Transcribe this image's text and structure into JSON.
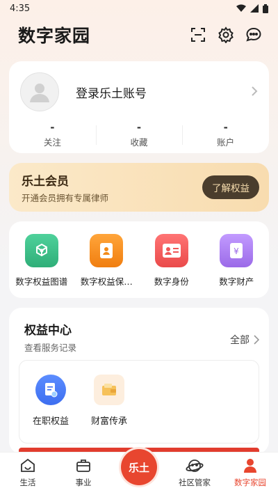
{
  "status": {
    "time": "4:35"
  },
  "header": {
    "title": "数字家园"
  },
  "profile": {
    "login": "登录乐土账号",
    "stats": [
      {
        "value": "-",
        "label": "关注"
      },
      {
        "value": "-",
        "label": "收藏"
      },
      {
        "value": "-",
        "label": "账户"
      }
    ]
  },
  "member": {
    "title": "乐土会员",
    "subtitle": "开通会员拥有专属律师",
    "button": "了解权益"
  },
  "features": [
    {
      "label": "数字权益图谱",
      "icon": "graph-icon",
      "color": "#3cc08c"
    },
    {
      "label": "数字权益保…",
      "icon": "contact-card-icon",
      "color": "#f7941d"
    },
    {
      "label": "数字身份",
      "icon": "id-card-icon",
      "color": "#f25a5a"
    },
    {
      "label": "数字财产",
      "icon": "yen-card-icon",
      "color": "#a97cf0"
    }
  ],
  "rights": {
    "title": "权益中心",
    "subtitle": "查看服务记录",
    "all": "全部",
    "items": [
      {
        "label": "在职权益",
        "icon": "document-icon"
      },
      {
        "label": "财富传承",
        "icon": "wallet-icon"
      }
    ]
  },
  "tabs": [
    {
      "label": "生活",
      "icon": "smile-house-icon"
    },
    {
      "label": "事业",
      "icon": "briefcase-icon"
    },
    {
      "label": "乐土",
      "icon": "center-logo"
    },
    {
      "label": "社区管家",
      "icon": "planet-icon"
    },
    {
      "label": "数字家园",
      "icon": "person-icon",
      "active": true
    }
  ]
}
